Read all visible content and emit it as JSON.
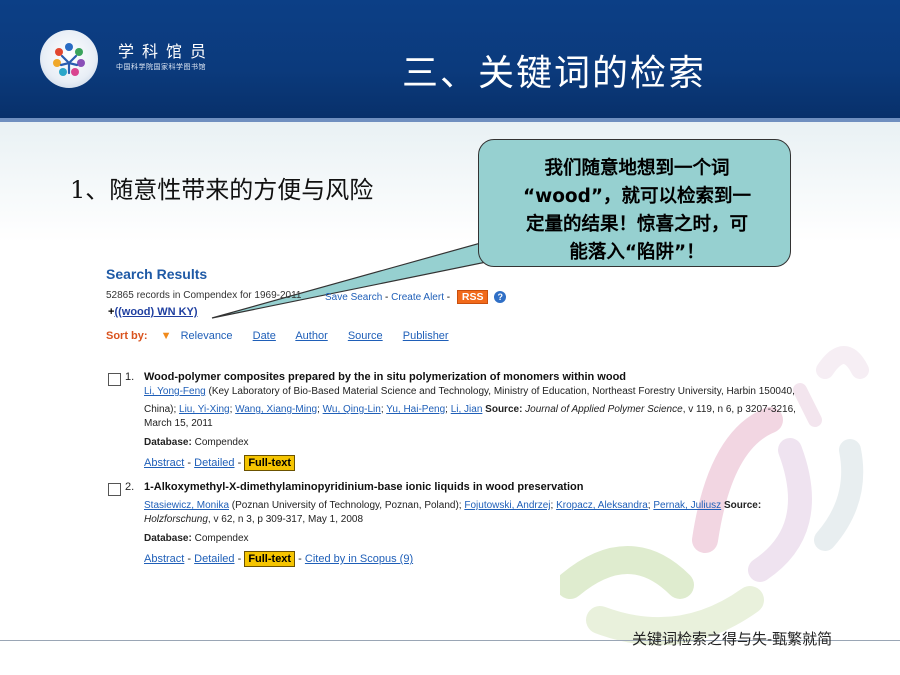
{
  "header": {
    "brand_name": "学科馆员",
    "brand_sub": "中国科学院国家科学图书馆",
    "slide_title": "三、关键词的检索"
  },
  "subtitle": "1、随意性带来的方便与风险",
  "callout": {
    "line1": "我们随意地想到一个词",
    "line2": "“wood”，就可以检索到一",
    "line3": "定量的结果！惊喜之时，可",
    "line4": "能落入“陷阱”！"
  },
  "search": {
    "title": "Search Results",
    "count_text": "52865 records in Compendex for 1969-2011",
    "save_search": "Save Search",
    "create_alert": "Create Alert",
    "rss": "RSS",
    "help": "?",
    "query_prefix": "+",
    "query": "((wood) WN KY)",
    "sort_label": "Sort by:",
    "sort_options": [
      "Relevance",
      "Date",
      "Author",
      "Source",
      "Publisher"
    ],
    "sep": "-",
    "records": [
      {
        "num": "1.",
        "title": "Wood-polymer composites prepared by the in situ polymerization of monomers within wood",
        "a1": "Li, Yong-Feng",
        "aff1": " (Key Laboratory of Bio-Based Material Science and Technology, Ministry of Education, Northeast Forestry University, Harbin 150040,",
        "aff1b": "China); ",
        "a2": "Liu, Yi-Xing",
        "a3": "Wang, Xiang-Ming",
        "a4": "Wu, Qing-Lin",
        "a5": "Yu, Hai-Peng",
        "a6": "Li, Jian",
        "source_label": "Source:",
        "source": " Journal of Applied Polymer Science",
        "source_rest": ", v 119, n 6, p 3207-3216,",
        "date": "March 15, 2011",
        "db_label": "Database:",
        "db": " Compendex",
        "abstract": "Abstract",
        "detailed": "Detailed",
        "fulltext": "Full-text"
      },
      {
        "num": "2.",
        "title": "1-Alkoxymethyl-X-dimethylaminopyridinium-base ionic liquids in wood preservation",
        "a1": "Stasiewicz, Monika",
        "aff1": " (Poznan University of Technology, Poznan, Poland); ",
        "a2": "Fojutowski, Andrzej",
        "a3": "Kropacz, Aleksandra",
        "a4": "Pernak, Juliusz",
        "source_label": "Source:",
        "source": "Holzforschung",
        "source_rest": ", v 62, n 3, p 309-317, May 1, 2008",
        "db_label": "Database:",
        "db": " Compendex",
        "abstract": "Abstract",
        "detailed": "Detailed",
        "fulltext": "Full-text",
        "cited": "Cited by in Scopus (9)"
      }
    ]
  },
  "footer": "关键词检索之得与失-甄繁就简",
  "colors": {
    "header_bg": "#0b3a7c",
    "callout_bg": "#96d0d0",
    "link": "#1f5fb8",
    "sort_label": "#d9531e",
    "fulltext_bg": "#f5c400",
    "rss_bg": "#f26a1b"
  }
}
